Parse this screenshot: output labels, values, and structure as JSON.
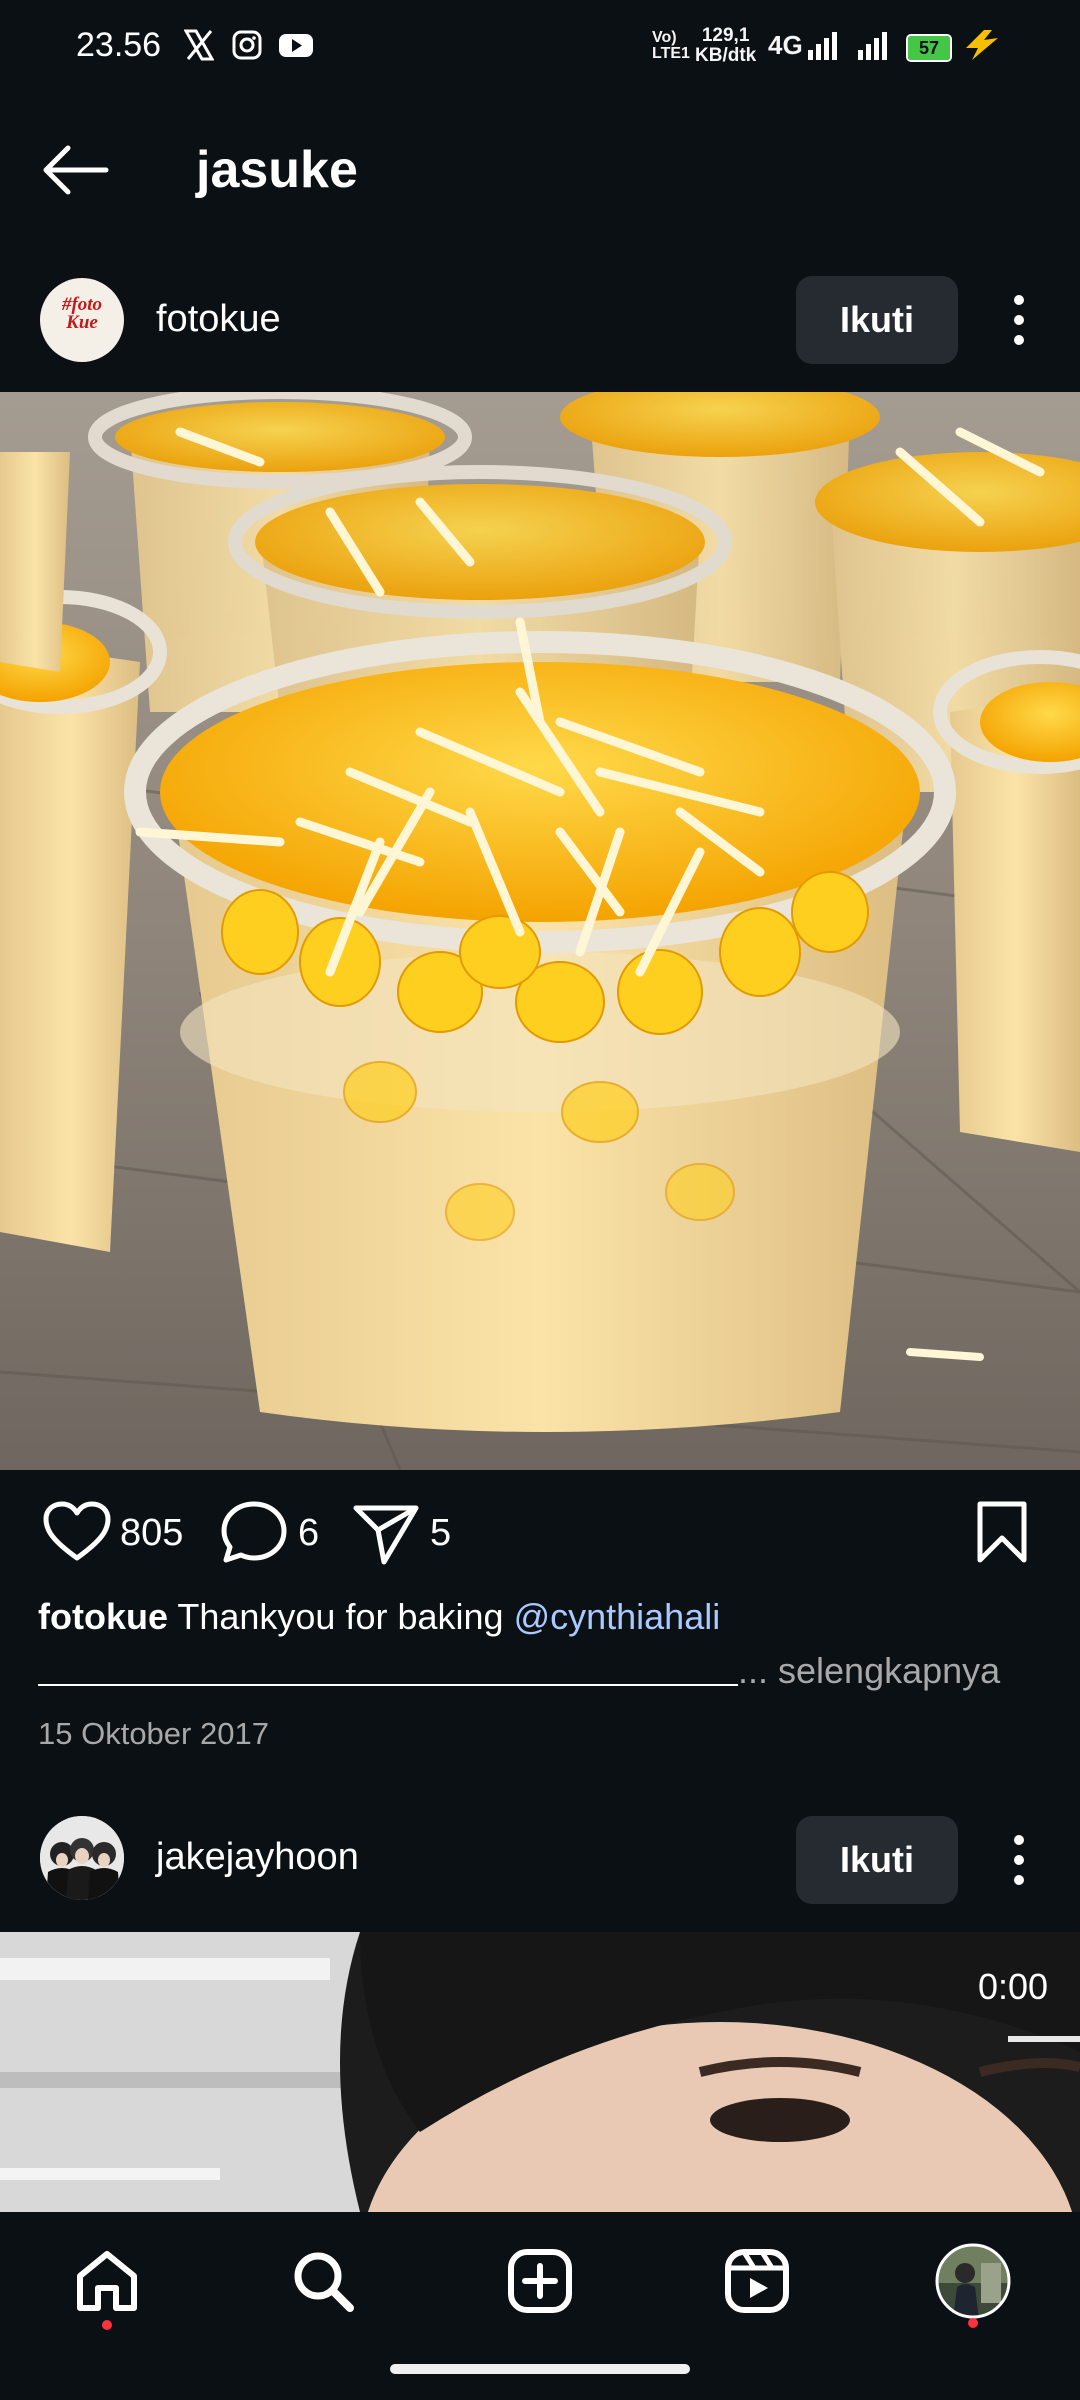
{
  "status_bar": {
    "time": "23.56",
    "net_speed_top": "129,1",
    "net_speed_bottom": "KB/dtk",
    "volte_top": "Vo)",
    "volte_bottom": "LTE1",
    "network": "4G",
    "battery": "57",
    "app_icons": [
      "x-icon",
      "instagram-icon",
      "youtube-icon"
    ]
  },
  "header": {
    "title": "jasuke"
  },
  "post1": {
    "username": "fotokue",
    "avatar_text_1": "#foto",
    "avatar_text_2": "Kue",
    "follow_label": "Ikuti",
    "likes": "805",
    "comments": "6",
    "shares": "5",
    "caption_user": "fotokue",
    "caption_text": " Thankyou for baking ",
    "caption_mention": "@cynthiahali",
    "more_label": "... selengkapnya",
    "date": "15 Oktober 2017"
  },
  "post2": {
    "username": "jakejayhoon",
    "follow_label": "Ikuti",
    "video_time": "0:00"
  },
  "colors": {
    "background": "#0b1014",
    "follow_button": "#262b31",
    "mention": "#a9c9ff",
    "notification_dot": "#ff3040"
  },
  "bottom_nav": [
    "home-icon",
    "search-icon",
    "create-icon",
    "reels-icon",
    "profile-avatar"
  ]
}
